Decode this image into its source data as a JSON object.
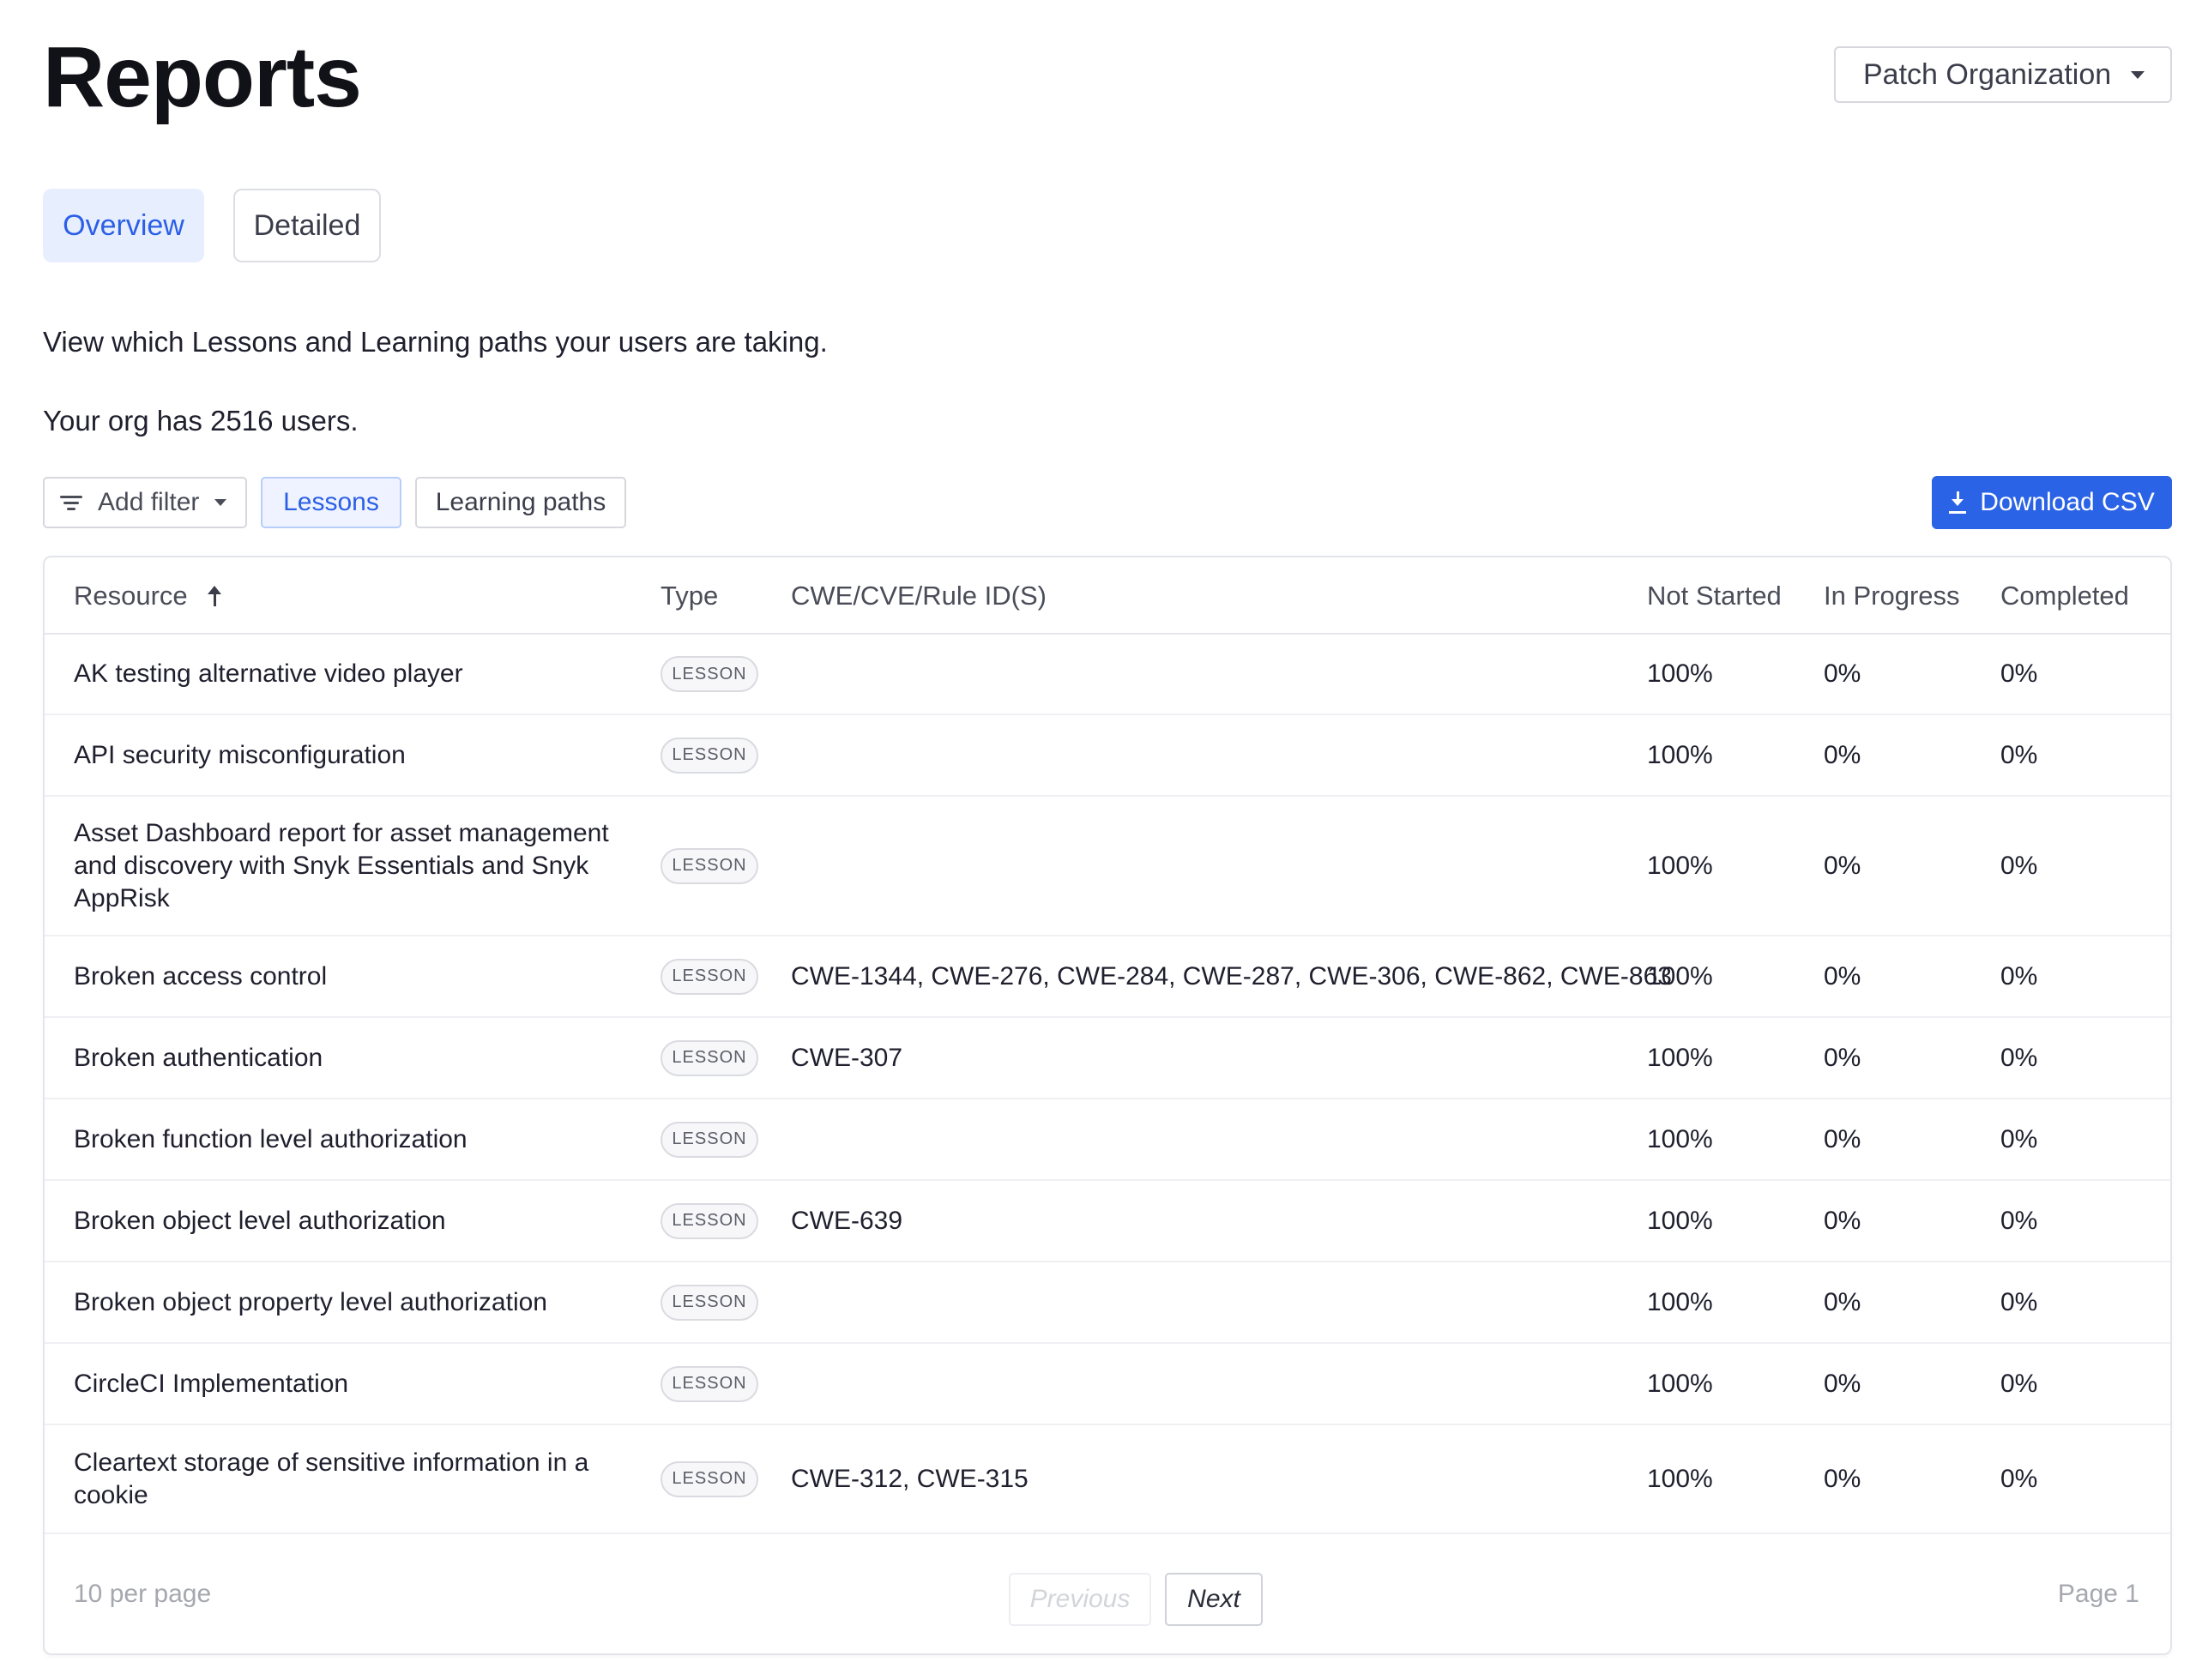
{
  "header": {
    "title": "Reports",
    "org_selector": {
      "label": "Patch Organization",
      "icon": "chevron-down-icon"
    }
  },
  "tabs": [
    {
      "label": "Overview",
      "active": true
    },
    {
      "label": "Detailed",
      "active": false
    }
  ],
  "intro_text": "View which Lessons and Learning paths your users are taking.",
  "user_count_text": "Your org has 2516 users.",
  "filters": {
    "add_filter_label": "Add filter",
    "lessons_label": "Lessons",
    "learning_paths_label": "Learning paths",
    "lessons_active": true
  },
  "download": {
    "label": "Download CSV",
    "icon": "download-icon"
  },
  "table": {
    "columns": {
      "resource": "Resource",
      "type": "Type",
      "ids": "CWE/CVE/Rule ID(S)",
      "not_started": "Not Started",
      "in_progress": "In Progress",
      "completed": "Completed"
    },
    "sort": {
      "column": "resource",
      "direction": "ascending"
    },
    "rows": [
      {
        "resource": "AK testing alternative video player",
        "type": "LESSON",
        "ids": "",
        "not_started": "100%",
        "in_progress": "0%",
        "completed": "0%"
      },
      {
        "resource": "API security misconfiguration",
        "type": "LESSON",
        "ids": "",
        "not_started": "100%",
        "in_progress": "0%",
        "completed": "0%"
      },
      {
        "resource": "Asset Dashboard report for asset management and discovery with Snyk Essentials and Snyk AppRisk",
        "type": "LESSON",
        "ids": "",
        "not_started": "100%",
        "in_progress": "0%",
        "completed": "0%"
      },
      {
        "resource": "Broken access control",
        "type": "LESSON",
        "ids": "CWE-1344, CWE-276, CWE-284, CWE-287, CWE-306, CWE-862, CWE-863",
        "not_started": "100%",
        "in_progress": "0%",
        "completed": "0%"
      },
      {
        "resource": "Broken authentication",
        "type": "LESSON",
        "ids": "CWE-307",
        "not_started": "100%",
        "in_progress": "0%",
        "completed": "0%"
      },
      {
        "resource": "Broken function level authorization",
        "type": "LESSON",
        "ids": "",
        "not_started": "100%",
        "in_progress": "0%",
        "completed": "0%"
      },
      {
        "resource": "Broken object level authorization",
        "type": "LESSON",
        "ids": "CWE-639",
        "not_started": "100%",
        "in_progress": "0%",
        "completed": "0%"
      },
      {
        "resource": "Broken object property level authorization",
        "type": "LESSON",
        "ids": "",
        "not_started": "100%",
        "in_progress": "0%",
        "completed": "0%"
      },
      {
        "resource": "CircleCI Implementation",
        "type": "LESSON",
        "ids": "",
        "not_started": "100%",
        "in_progress": "0%",
        "completed": "0%"
      },
      {
        "resource": "Cleartext storage of sensitive information in a cookie",
        "type": "LESSON",
        "ids": "CWE-312, CWE-315",
        "not_started": "100%",
        "in_progress": "0%",
        "completed": "0%"
      }
    ]
  },
  "pagination": {
    "per_page_label": "10 per page",
    "previous_label": "Previous",
    "next_label": "Next",
    "page_label": "Page 1",
    "previous_disabled": true
  },
  "colors": {
    "accent": "#2b63e6",
    "tab_active_bg": "#e7efff",
    "text_primary": "#1f1f2e",
    "border": "#d6d8de"
  }
}
